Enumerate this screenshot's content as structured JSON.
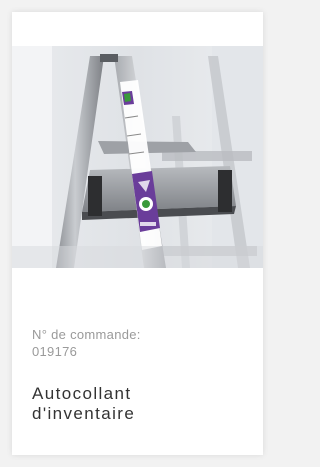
{
  "product": {
    "order_label": "N° de commande:",
    "order_number": "019176",
    "name_line1": "Autocollant",
    "name_line2": "d'inventaire",
    "image_subject": "ladder-with-inventory-sticker"
  },
  "colors": {
    "background": "#f2f2f2",
    "card": "#ffffff",
    "muted_text": "#9a9a9a",
    "title_text": "#333333",
    "sticker_accent": "#6a3d9a",
    "sticker_green": "#3a9a3a"
  }
}
